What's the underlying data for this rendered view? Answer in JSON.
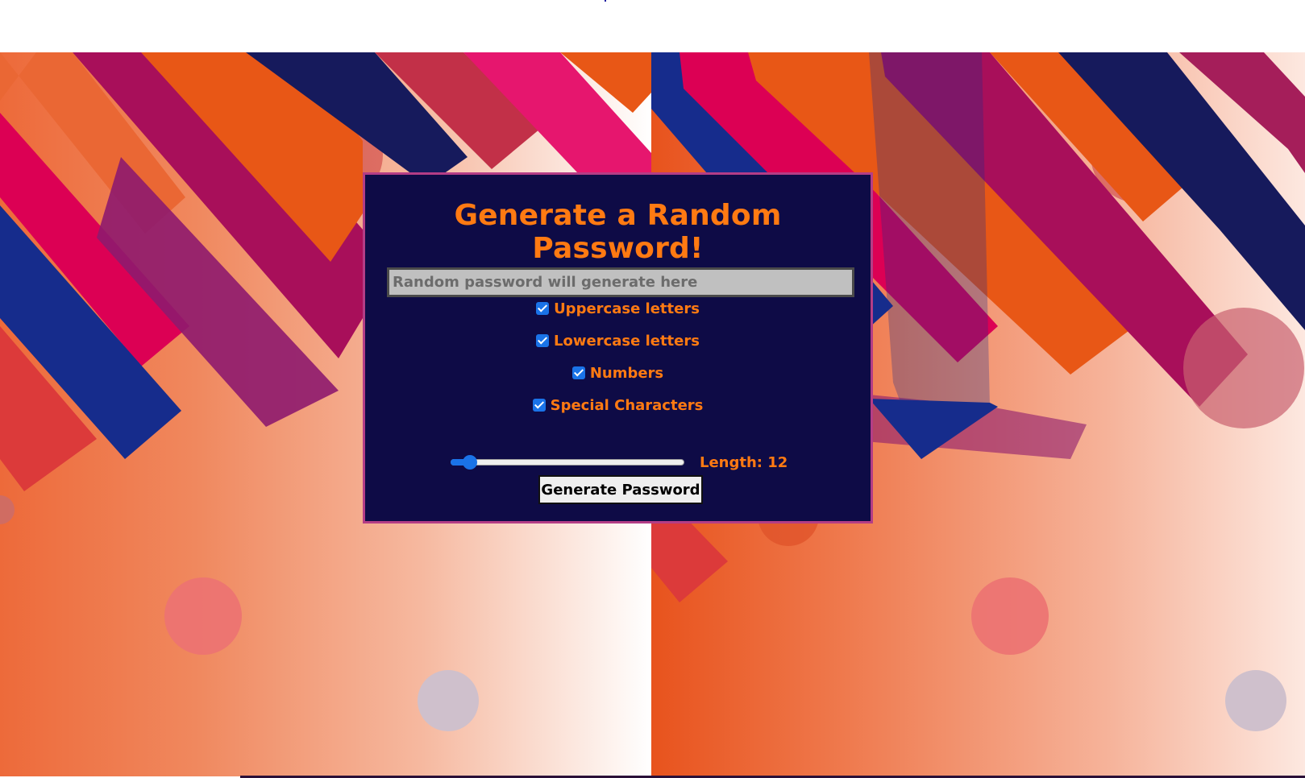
{
  "panel": {
    "title": "Generate a Random Password!",
    "password_placeholder": "Random password will generate here",
    "password_value": "",
    "options": [
      {
        "label": "Uppercase letters",
        "checked": true
      },
      {
        "label": "Lowercase letters",
        "checked": true
      },
      {
        "label": "Numbers",
        "checked": true
      },
      {
        "label": "Special Characters",
        "checked": true
      }
    ],
    "length_label": "Length:",
    "length_value": "12",
    "slider_fraction": 0.05,
    "generate_button": "Generate Password"
  },
  "colors": {
    "panel_bg": "#0e0b46",
    "panel_border": "#b43d86",
    "accent_text": "#ff7a12",
    "checkbox": "#1a73e8"
  }
}
